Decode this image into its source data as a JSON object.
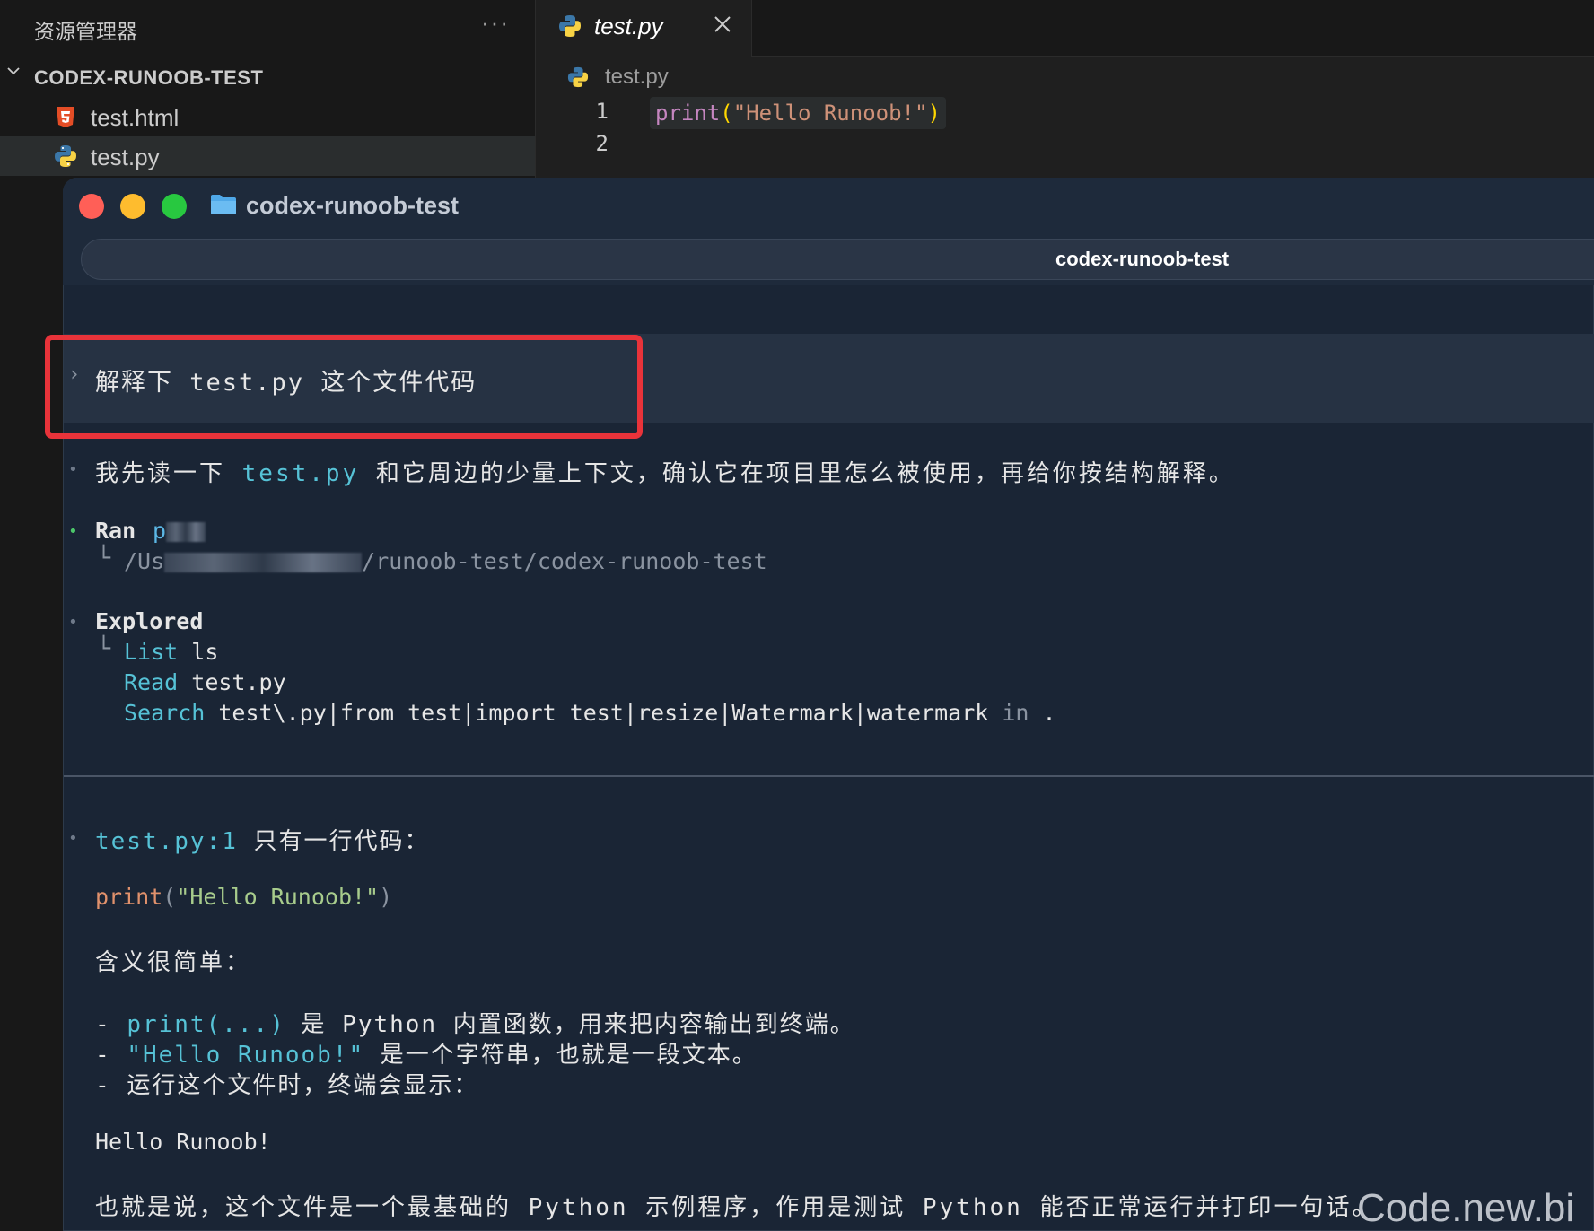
{
  "explorer": {
    "title": "资源管理器",
    "more": "···",
    "project": "CODEX-RUNOOB-TEST",
    "files": [
      {
        "name": "test.html",
        "icon": "html5-icon"
      },
      {
        "name": "test.py",
        "icon": "python-icon",
        "selected": true
      }
    ]
  },
  "editor": {
    "tab_label": "test.py",
    "breadcrumb": "test.py",
    "line_numbers": [
      "1",
      "2"
    ],
    "code": {
      "fn": "print",
      "open": "(",
      "str": "\"Hello Runoob!\"",
      "close": ")"
    }
  },
  "terminal": {
    "window_title": "codex-runoob-test",
    "tab_title": "codex-runoob-test",
    "prompt_marker": "›",
    "prompt": "解释下 test.py 这个文件代码",
    "intro": {
      "a": "我先读一下 ",
      "file": "test.py",
      "b": " 和它周边的少量上下文，确认它在项目里怎么被使用，再给你按结构解释。"
    },
    "ran": {
      "label": "Ran",
      "cmd_prefix": "p",
      "path_prefix": "/Us",
      "path_suffix": "/runoob-test/codex-runoob-test"
    },
    "explored": {
      "label": "Explored",
      "items": [
        {
          "verb": "List",
          "arg": "ls"
        },
        {
          "verb": "Read",
          "arg": "test.py"
        },
        {
          "verb": "Search",
          "arg": "test\\.py|from test|import test|resize|Watermark|watermark",
          "suffix": "in",
          "tail": "."
        }
      ]
    },
    "answer": {
      "ref": "test.py:1",
      "ref_text": " 只有一行代码：",
      "code_fn": "print",
      "code_open": "(",
      "code_str": "\"Hello Runoob!\"",
      "code_close": ")",
      "meaning": "含义很简单：",
      "points": [
        {
          "dash": "- ",
          "code": "print(...)",
          "text": " 是 Python 内置函数，用来把内容输出到终端。"
        },
        {
          "dash": "- ",
          "code": "\"Hello Runoob!\"",
          "text": " 是一个字符串，也就是一段文本。"
        },
        {
          "dash": "- ",
          "code": "",
          "text": "运行这个文件时，终端会显示："
        }
      ],
      "output": "Hello Runoob!",
      "summary": "也就是说，这个文件是一个最基础的 Python 示例程序，作用是测试 Python 能否正常运行并打印一句话。"
    }
  },
  "watermark": "Code.new.bi",
  "colors": {
    "accent_red": "#e8333a",
    "terminal_bg": "#1a2535",
    "cyan": "#56c2d6"
  }
}
